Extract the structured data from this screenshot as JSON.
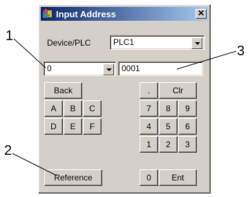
{
  "dialog": {
    "title": "Input Address",
    "close_label": "✕",
    "device_label": "Device/PLC",
    "device_value": "PLC1",
    "address_type_value": "0",
    "address_value": "0001"
  },
  "buttons": {
    "back": "Back",
    "dot": ".",
    "clr": "Clr",
    "a": "A",
    "b": "B",
    "c": "C",
    "d": "D",
    "e": "E",
    "f": "F",
    "n7": "7",
    "n8": "8",
    "n9": "9",
    "n4": "4",
    "n5": "5",
    "n6": "6",
    "n1": "1",
    "n2": "2",
    "n3": "3",
    "n0": "0",
    "ent": "Ent",
    "reference": "Reference"
  },
  "callouts": [
    "1",
    "2",
    "3"
  ],
  "icons": {
    "title": "app-icon",
    "dropdown": "chevron-down-icon",
    "close": "close-icon"
  }
}
